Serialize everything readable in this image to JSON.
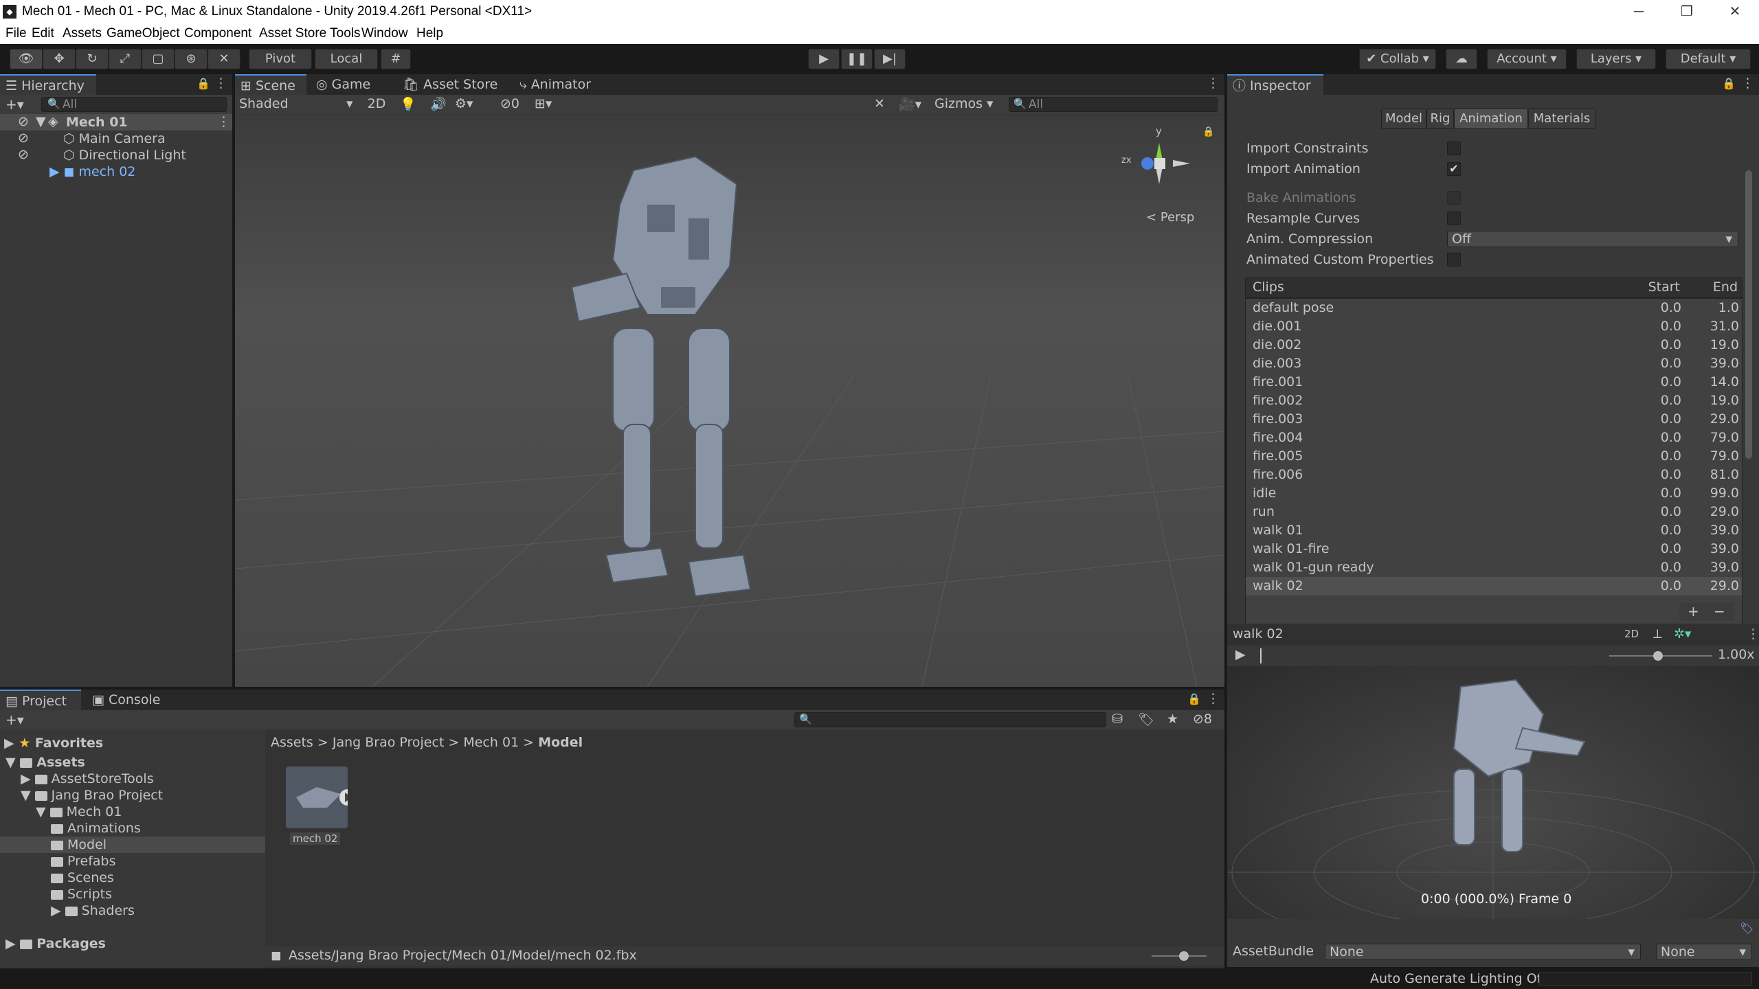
{
  "window": {
    "title": "Mech 01 - Mech 01 - PC, Mac & Linux Standalone - Unity 2019.4.26f1 Personal <DX11>",
    "app_icon": "unity-icon",
    "minimize": "─",
    "maximize": "❐",
    "close": "✕"
  },
  "menu": [
    "File",
    "Edit",
    "Assets",
    "GameObject",
    "Component",
    "Asset Store Tools",
    "Window",
    "Help"
  ],
  "toolbar": {
    "pivot": "Pivot",
    "local": "Local",
    "collab": "Collab",
    "account": "Account",
    "layers": "Layers",
    "layout": "Default"
  },
  "hierarchy": {
    "tab": "Hierarchy",
    "search": "All",
    "scene": "Mech 01",
    "items": [
      "Main Camera",
      "Directional Light",
      "mech 02"
    ]
  },
  "scene_tabs": [
    "Scene",
    "Game",
    "Asset Store",
    "Animator"
  ],
  "scene_bar": {
    "shading": "Shaded",
    "mode_2d": "2D",
    "hidden_count": "0",
    "gizmos": "Gizmos",
    "search": "All"
  },
  "scene_view": {
    "persp": "Persp",
    "gizmo_y": "y",
    "gizmo_zx": "zx"
  },
  "inspector": {
    "tab": "Inspector",
    "subtabs": [
      "Model",
      "Rig",
      "Animation",
      "Materials"
    ],
    "settings": [
      {
        "label": "Import Constraints",
        "checked": false
      },
      {
        "label": "Import Animation",
        "checked": true
      },
      {
        "label": "Bake Animations",
        "checked": false,
        "disabled": true
      },
      {
        "label": "Resample Curves",
        "checked": false
      }
    ],
    "anim_compression_label": "Anim. Compression",
    "anim_compression_value": "Off",
    "animated_custom_label": "Animated Custom Properties",
    "clips_header": {
      "name": "Clips",
      "start": "Start",
      "end": "End"
    },
    "clips": [
      {
        "name": "default pose",
        "start": "0.0",
        "end": "1.0"
      },
      {
        "name": "die.001",
        "start": "0.0",
        "end": "31.0"
      },
      {
        "name": "die.002",
        "start": "0.0",
        "end": "19.0"
      },
      {
        "name": "die.003",
        "start": "0.0",
        "end": "39.0"
      },
      {
        "name": "fire.001",
        "start": "0.0",
        "end": "14.0"
      },
      {
        "name": "fire.002",
        "start": "0.0",
        "end": "19.0"
      },
      {
        "name": "fire.003",
        "start": "0.0",
        "end": "29.0"
      },
      {
        "name": "fire.004",
        "start": "0.0",
        "end": "79.0"
      },
      {
        "name": "fire.005",
        "start": "0.0",
        "end": "79.0"
      },
      {
        "name": "fire.006",
        "start": "0.0",
        "end": "81.0"
      },
      {
        "name": "idle",
        "start": "0.0",
        "end": "99.0"
      },
      {
        "name": "run",
        "start": "0.0",
        "end": "29.0"
      },
      {
        "name": "walk 01",
        "start": "0.0",
        "end": "39.0"
      },
      {
        "name": "walk 01-fire",
        "start": "0.0",
        "end": "39.0"
      },
      {
        "name": "walk 01-gun ready",
        "start": "0.0",
        "end": "39.0"
      },
      {
        "name": "walk 02",
        "start": "0.0",
        "end": "29.0"
      }
    ],
    "add": "+",
    "remove": "−",
    "preview_title": "walk 02",
    "preview_2d": "2D",
    "speed": "1.00x",
    "frame_info": "0:00 (000.0%) Frame 0",
    "assetbundle_label": "AssetBundle",
    "assetbundle_value": "None",
    "assetbundle_variant": "None"
  },
  "project": {
    "tabs": [
      "Project",
      "Console"
    ],
    "favorites": "Favorites",
    "tree": [
      {
        "label": "Assets",
        "depth": 0,
        "bold": true
      },
      {
        "label": "AssetStoreTools",
        "depth": 1
      },
      {
        "label": "Jang Brao Project",
        "depth": 1
      },
      {
        "label": "Mech 01",
        "depth": 2
      },
      {
        "label": "Animations",
        "depth": 3
      },
      {
        "label": "Model",
        "depth": 3,
        "selected": true
      },
      {
        "label": "Prefabs",
        "depth": 3
      },
      {
        "label": "Scenes",
        "depth": 3
      },
      {
        "label": "Scripts",
        "depth": 3
      },
      {
        "label": "Shaders",
        "depth": 3
      },
      {
        "label": "Packages",
        "depth": 0,
        "bold": true
      }
    ],
    "breadcrumb": [
      "Assets",
      "Jang Brao Project",
      "Mech 01",
      "Model"
    ],
    "asset_name": "mech 02",
    "path": "Assets/Jang Brao Project/Mech 01/Model/mech 02.fbx",
    "hidden_count": "8"
  },
  "status": {
    "lighting": "Auto Generate Lighting Off"
  }
}
